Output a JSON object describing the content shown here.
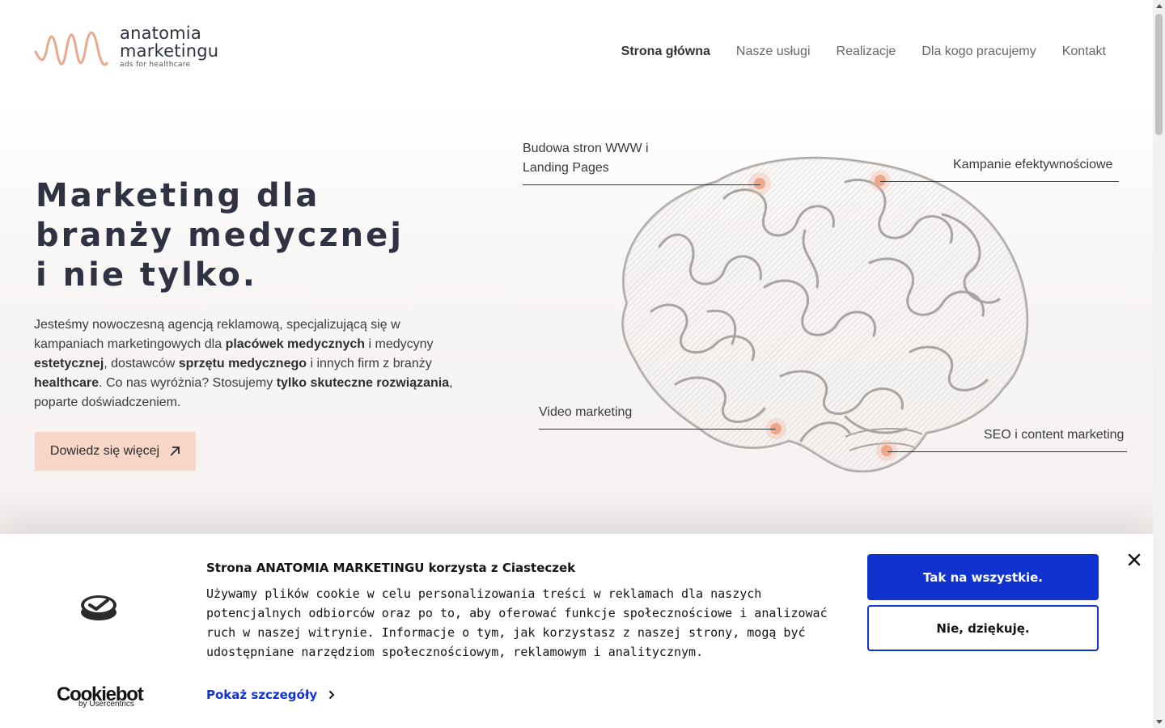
{
  "header": {
    "logo": {
      "name_line1": "anatomia",
      "name_line2": "marketingu",
      "tagline": "ads for healthcare"
    },
    "nav": [
      {
        "label": "Strona główna",
        "active": true
      },
      {
        "label": "Nasze usługi"
      },
      {
        "label": "Realizacje"
      },
      {
        "label": "Dla kogo pracujemy"
      },
      {
        "label": "Kontakt"
      }
    ]
  },
  "hero": {
    "title_line1": "Marketing dla",
    "title_line2": "branży medycznej",
    "title_line3": "i nie tylko.",
    "text": {
      "p1": "Jesteśmy nowoczesną agencją reklamową, specjalizującą się w kampaniach marketingowych dla ",
      "b1": "placówek medycznych",
      "p2": " i medycyny ",
      "b2": "estetycznej",
      "p3": ", dostawców ",
      "b3": "sprzętu medycznego",
      "p4": " i innych firm z branży ",
      "b4": "healthcare",
      "p5": ". Co nas wyróżnia? Stosujemy ",
      "b5": "tylko skuteczne rozwiązania",
      "p6": ", poparte doświadczeniem."
    },
    "cta_label": "Dowiedz się więcej",
    "cta_icon": "arrow-up-right-icon"
  },
  "brain_labels": {
    "www_line1": "Budowa stron WWW i",
    "www_line2": "Landing Pages",
    "campaigns": "Kampanie efektywnościowe",
    "video": "Video marketing",
    "seo": "SEO i content marketing"
  },
  "cookie_banner": {
    "title": "Strona ANATOMIA MARKETINGU korzysta z Ciasteczek",
    "body": "Używamy plików cookie w celu personalizowania treści w reklamach dla naszych potencjalnych odbiorców oraz po to, aby oferować funkcje społecznościowe i analizować ruch w naszej witrynie. Informacje o tym, jak korzystasz z naszej strony, mogą być udostępniane narzędziom społecznościowym, reklamowym i analitycznym.",
    "details_label": "Pokaż szczegóły",
    "accept_label": "Tak na wszystkie.",
    "decline_label": "Nie, dziękuję.",
    "brand": "Cookiebot",
    "brand_sub": "by Usercentrics"
  },
  "colors": {
    "accent_peach": "#f7d6c8",
    "logo_wave": "#e8a98f",
    "cookie_blue": "#1032cf",
    "text_dark": "#2f3242"
  }
}
